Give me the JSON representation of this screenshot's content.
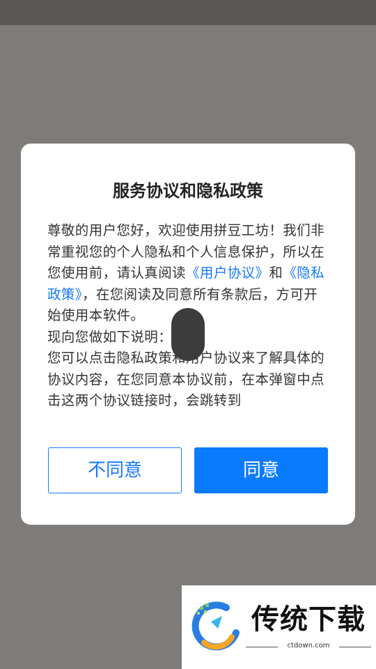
{
  "dialog": {
    "title": "服务协议和隐私政策",
    "body": {
      "p1_prefix": "尊敬的用户您好，欢迎使用拼豆工坊！我们非常重视您的个人隐私和个人信息保护，所以在您使用前，请认真阅读",
      "user_agreement_link": "《用户协议》",
      "and": "和",
      "privacy_policy_link": "《隐私政策》",
      "p1_suffix": "，在您阅读及同意所有条款后，方可开始使用本软件。",
      "p2": "现向您做如下说明：",
      "p3": "您可以点击隐私政策和用户协议来了解具体的协议内容，在您同意本协议前，在本弹窗中点击这两个协议链接时，会跳转到"
    },
    "disagree_label": "不同意",
    "agree_label": "同意"
  },
  "watermark": {
    "brand": "传统下载",
    "domain": "ctdown.com"
  },
  "colors": {
    "overlay": "#7f7b78",
    "accent": "#0a7bff",
    "link": "#1677ff"
  }
}
